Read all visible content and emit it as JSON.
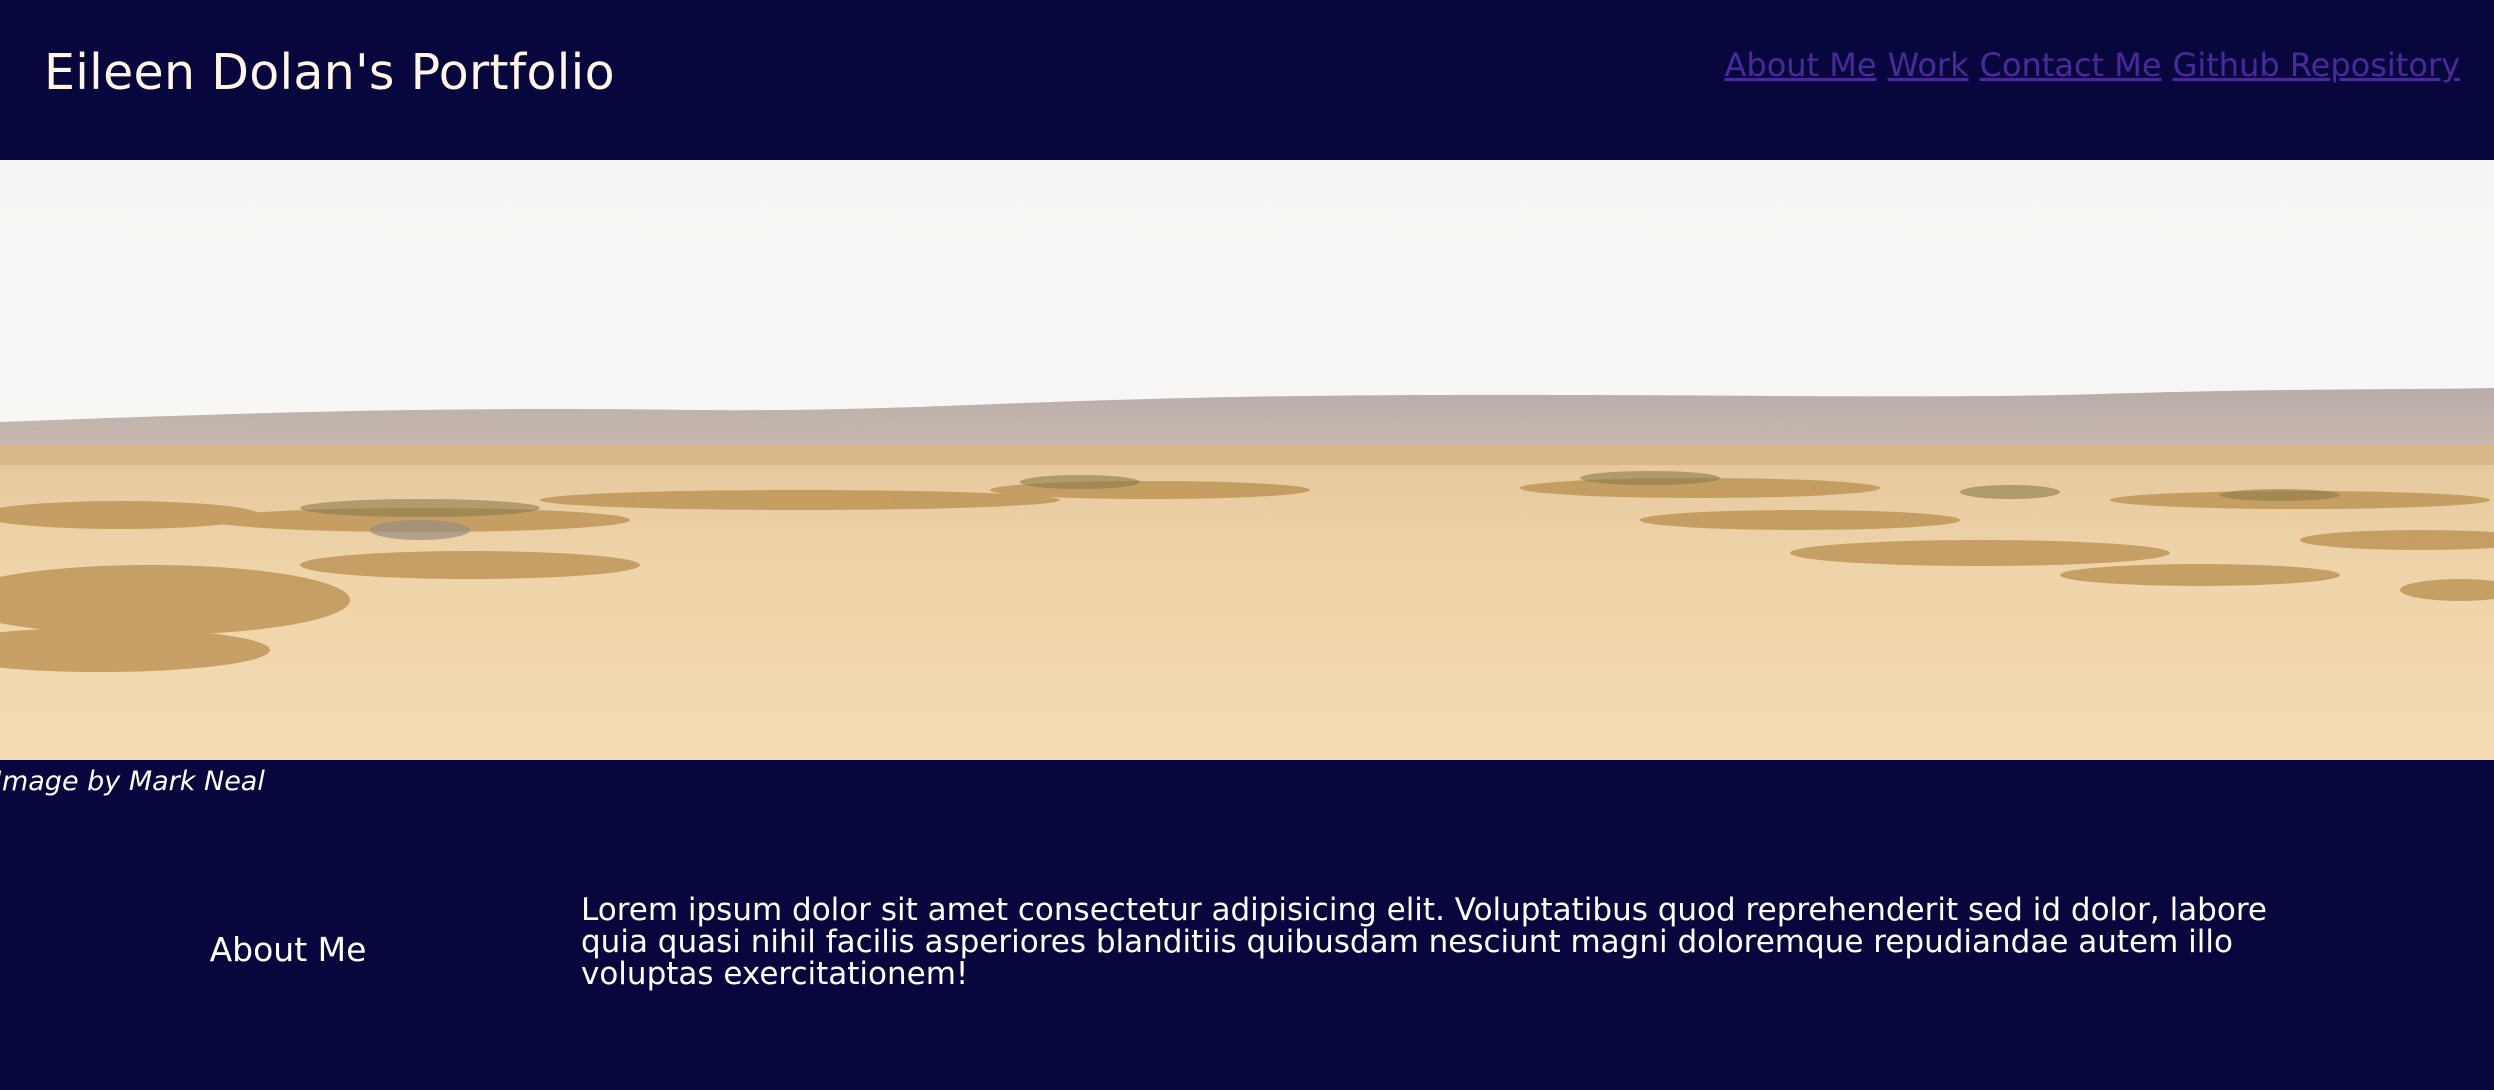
{
  "header": {
    "title": "Eileen Dolan's Portfolio",
    "nav": [
      {
        "label": "About Me"
      },
      {
        "label": "Work"
      },
      {
        "label": "Contact Me"
      },
      {
        "label": "Github Repository"
      }
    ]
  },
  "hero": {
    "caption": "Image by Mark Neal",
    "scene": "desert-landscape-photo"
  },
  "about": {
    "heading": "About Me",
    "body": "Lorem ipsum dolor sit amet consectetur adipisicing elit. Voluptatibus quod reprehenderit sed id dolor, labore quia quasi nihil facilis asperiores blanditiis quibusdam nesciunt magni doloremque repudiandae autem illo voluptas exercitationem!"
  },
  "colors": {
    "background": "#07073d",
    "title_text": "#fff6e6",
    "nav_link": "#4a2a9a",
    "body_text": "#ffffff"
  }
}
